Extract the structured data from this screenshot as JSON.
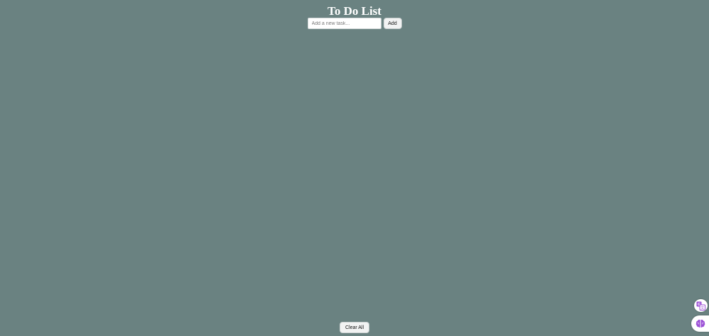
{
  "app": {
    "title": "To Do List"
  },
  "add_form": {
    "input_value": "",
    "input_placeholder": "Add a new task...",
    "add_label": "Add"
  },
  "tasks": [],
  "footer": {
    "clear_label": "Clear All"
  },
  "extensions": {
    "translate_icon": "translate-icon",
    "brain_icon": "brain-icon",
    "accent_color": "#9b4fd6"
  },
  "colors": {
    "background": "#6a8281",
    "title": "#ffffff"
  }
}
